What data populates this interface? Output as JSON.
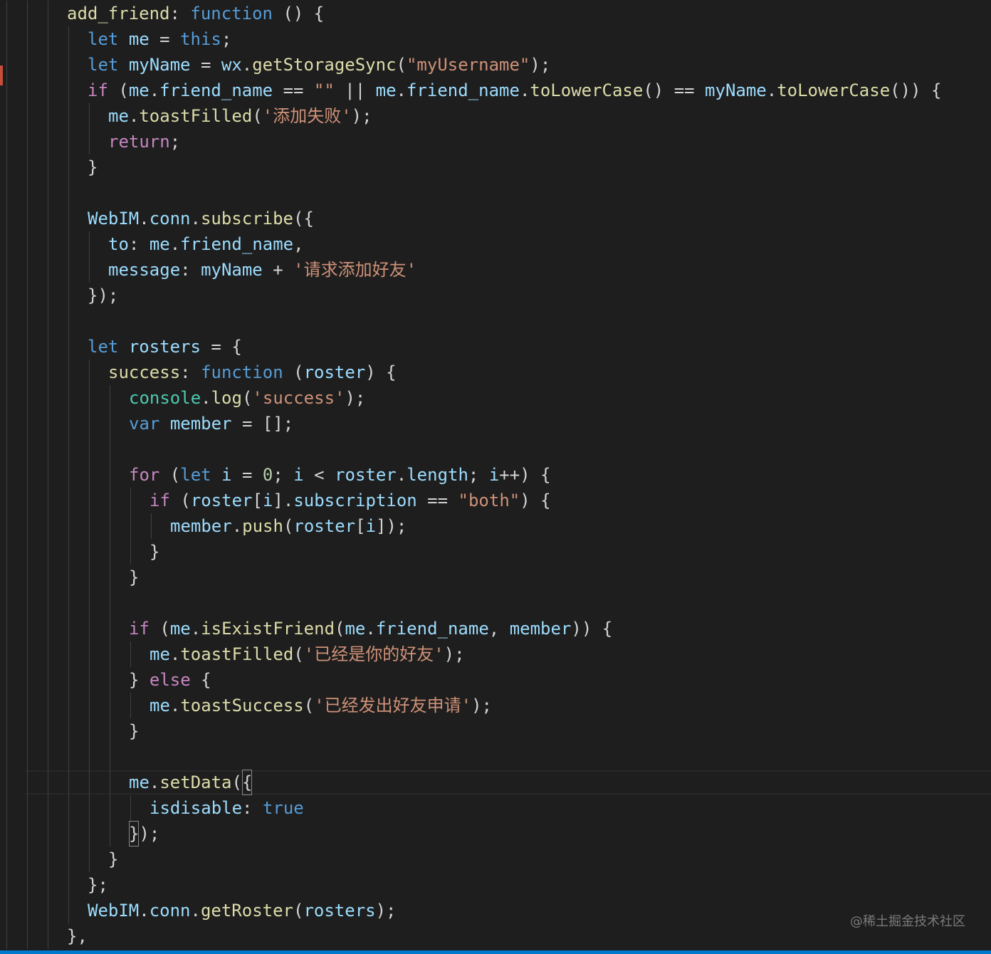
{
  "colors": {
    "background": "#1e1e1e",
    "plain": "#d4d4d4",
    "keyword": "#569cd6",
    "control": "#c586c0",
    "variable": "#9cdcfe",
    "function": "#dcdcaa",
    "string": "#ce9178",
    "number": "#b5cea8",
    "class": "#4ec9b0",
    "statusbar": "#007acc",
    "gutter_marker": "#c74e39"
  },
  "watermark": "@稀土掘金技术社区",
  "code": {
    "lines": [
      {
        "indent": 3,
        "tokens": [
          [
            "add_friend",
            "fn"
          ],
          [
            ": ",
            "p"
          ],
          [
            "function",
            "kw"
          ],
          [
            " () {",
            "p"
          ]
        ]
      },
      {
        "indent": 4,
        "tokens": [
          [
            "let",
            "kw"
          ],
          [
            " ",
            "p"
          ],
          [
            "me",
            "var"
          ],
          [
            " = ",
            "p"
          ],
          [
            "this",
            "kw"
          ],
          [
            ";",
            "p"
          ]
        ]
      },
      {
        "indent": 4,
        "tokens": [
          [
            "let",
            "kw"
          ],
          [
            " ",
            "p"
          ],
          [
            "myName",
            "var"
          ],
          [
            " = ",
            "p"
          ],
          [
            "wx",
            "var"
          ],
          [
            ".",
            "p"
          ],
          [
            "getStorageSync",
            "fn"
          ],
          [
            "(",
            "p"
          ],
          [
            "\"myUsername\"",
            "str"
          ],
          [
            ");",
            "p"
          ]
        ]
      },
      {
        "indent": 4,
        "tokens": [
          [
            "if",
            "ctl"
          ],
          [
            " (",
            "p"
          ],
          [
            "me",
            "var"
          ],
          [
            ".",
            "p"
          ],
          [
            "friend_name",
            "var"
          ],
          [
            " == ",
            "p"
          ],
          [
            "\"\"",
            "str"
          ],
          [
            " || ",
            "p"
          ],
          [
            "me",
            "var"
          ],
          [
            ".",
            "p"
          ],
          [
            "friend_name",
            "var"
          ],
          [
            ".",
            "p"
          ],
          [
            "toLowerCase",
            "fn"
          ],
          [
            "() == ",
            "p"
          ],
          [
            "myName",
            "var"
          ],
          [
            ".",
            "p"
          ],
          [
            "toLowerCase",
            "fn"
          ],
          [
            "()) {",
            "p"
          ]
        ]
      },
      {
        "indent": 5,
        "tokens": [
          [
            "me",
            "var"
          ],
          [
            ".",
            "p"
          ],
          [
            "toastFilled",
            "fn"
          ],
          [
            "(",
            "p"
          ],
          [
            "'添加失败'",
            "str"
          ],
          [
            ");",
            "p"
          ]
        ]
      },
      {
        "indent": 5,
        "tokens": [
          [
            "return",
            "ctl"
          ],
          [
            ";",
            "p"
          ]
        ]
      },
      {
        "indent": 4,
        "tokens": [
          [
            "}",
            "p"
          ]
        ]
      },
      {
        "indent": 0,
        "tokens": []
      },
      {
        "indent": 4,
        "tokens": [
          [
            "WebIM",
            "var"
          ],
          [
            ".",
            "p"
          ],
          [
            "conn",
            "var"
          ],
          [
            ".",
            "p"
          ],
          [
            "subscribe",
            "fn"
          ],
          [
            "({",
            "p"
          ]
        ]
      },
      {
        "indent": 5,
        "tokens": [
          [
            "to",
            "var"
          ],
          [
            ": ",
            "p"
          ],
          [
            "me",
            "var"
          ],
          [
            ".",
            "p"
          ],
          [
            "friend_name",
            "var"
          ],
          [
            ",",
            "p"
          ]
        ]
      },
      {
        "indent": 5,
        "tokens": [
          [
            "message",
            "var"
          ],
          [
            ": ",
            "p"
          ],
          [
            "myName",
            "var"
          ],
          [
            " + ",
            "p"
          ],
          [
            "'请求添加好友'",
            "str"
          ]
        ]
      },
      {
        "indent": 4,
        "tokens": [
          [
            "});",
            "p"
          ]
        ]
      },
      {
        "indent": 0,
        "tokens": []
      },
      {
        "indent": 4,
        "tokens": [
          [
            "let",
            "kw"
          ],
          [
            " ",
            "p"
          ],
          [
            "rosters",
            "var"
          ],
          [
            " = {",
            "p"
          ]
        ]
      },
      {
        "indent": 5,
        "tokens": [
          [
            "success",
            "fn"
          ],
          [
            ": ",
            "p"
          ],
          [
            "function",
            "kw"
          ],
          [
            " (",
            "p"
          ],
          [
            "roster",
            "var"
          ],
          [
            ") {",
            "p"
          ]
        ]
      },
      {
        "indent": 6,
        "tokens": [
          [
            "console",
            "cls"
          ],
          [
            ".",
            "p"
          ],
          [
            "log",
            "fn"
          ],
          [
            "(",
            "p"
          ],
          [
            "'success'",
            "str"
          ],
          [
            ");",
            "p"
          ]
        ]
      },
      {
        "indent": 6,
        "tokens": [
          [
            "var",
            "kw"
          ],
          [
            " ",
            "p"
          ],
          [
            "member",
            "var"
          ],
          [
            " = [];",
            "p"
          ]
        ]
      },
      {
        "indent": 0,
        "tokens": []
      },
      {
        "indent": 6,
        "tokens": [
          [
            "for",
            "ctl"
          ],
          [
            " (",
            "p"
          ],
          [
            "let",
            "kw"
          ],
          [
            " ",
            "p"
          ],
          [
            "i",
            "var"
          ],
          [
            " = ",
            "p"
          ],
          [
            "0",
            "num"
          ],
          [
            "; ",
            "p"
          ],
          [
            "i",
            "var"
          ],
          [
            " < ",
            "p"
          ],
          [
            "roster",
            "var"
          ],
          [
            ".",
            "p"
          ],
          [
            "length",
            "var"
          ],
          [
            "; ",
            "p"
          ],
          [
            "i",
            "var"
          ],
          [
            "++) {",
            "p"
          ]
        ]
      },
      {
        "indent": 7,
        "tokens": [
          [
            "if",
            "ctl"
          ],
          [
            " (",
            "p"
          ],
          [
            "roster",
            "var"
          ],
          [
            "[",
            "p"
          ],
          [
            "i",
            "var"
          ],
          [
            "].",
            "p"
          ],
          [
            "subscription",
            "var"
          ],
          [
            " == ",
            "p"
          ],
          [
            "\"both\"",
            "str"
          ],
          [
            ") {",
            "p"
          ]
        ]
      },
      {
        "indent": 8,
        "tokens": [
          [
            "member",
            "var"
          ],
          [
            ".",
            "p"
          ],
          [
            "push",
            "fn"
          ],
          [
            "(",
            "p"
          ],
          [
            "roster",
            "var"
          ],
          [
            "[",
            "p"
          ],
          [
            "i",
            "var"
          ],
          [
            "]);",
            "p"
          ]
        ]
      },
      {
        "indent": 7,
        "tokens": [
          [
            "}",
            "p"
          ]
        ]
      },
      {
        "indent": 6,
        "tokens": [
          [
            "}",
            "p"
          ]
        ]
      },
      {
        "indent": 0,
        "tokens": []
      },
      {
        "indent": 6,
        "tokens": [
          [
            "if",
            "ctl"
          ],
          [
            " (",
            "p"
          ],
          [
            "me",
            "var"
          ],
          [
            ".",
            "p"
          ],
          [
            "isExistFriend",
            "fn"
          ],
          [
            "(",
            "p"
          ],
          [
            "me",
            "var"
          ],
          [
            ".",
            "p"
          ],
          [
            "friend_name",
            "var"
          ],
          [
            ", ",
            "p"
          ],
          [
            "member",
            "var"
          ],
          [
            ")) {",
            "p"
          ]
        ]
      },
      {
        "indent": 7,
        "tokens": [
          [
            "me",
            "var"
          ],
          [
            ".",
            "p"
          ],
          [
            "toastFilled",
            "fn"
          ],
          [
            "(",
            "p"
          ],
          [
            "'已经是你的好友'",
            "str"
          ],
          [
            ");",
            "p"
          ]
        ]
      },
      {
        "indent": 6,
        "tokens": [
          [
            "} ",
            "p"
          ],
          [
            "else",
            "ctl"
          ],
          [
            " {",
            "p"
          ]
        ]
      },
      {
        "indent": 7,
        "tokens": [
          [
            "me",
            "var"
          ],
          [
            ".",
            "p"
          ],
          [
            "toastSuccess",
            "fn"
          ],
          [
            "(",
            "p"
          ],
          [
            "'已经发出好友申请'",
            "str"
          ],
          [
            ");",
            "p"
          ]
        ]
      },
      {
        "indent": 6,
        "tokens": [
          [
            "}",
            "p"
          ]
        ]
      },
      {
        "indent": 0,
        "tokens": []
      },
      {
        "indent": 6,
        "tokens": [
          [
            "me",
            "var"
          ],
          [
            ".",
            "p"
          ],
          [
            "setData",
            "fn"
          ],
          [
            "(",
            "p"
          ],
          [
            "{",
            "box"
          ]
        ]
      },
      {
        "indent": 7,
        "tokens": [
          [
            "isdisable",
            "var"
          ],
          [
            ": ",
            "p"
          ],
          [
            "true",
            "kw"
          ]
        ]
      },
      {
        "indent": 6,
        "tokens": [
          [
            "}",
            "box"
          ],
          [
            ");",
            "p"
          ]
        ]
      },
      {
        "indent": 5,
        "tokens": [
          [
            "}",
            "p"
          ]
        ]
      },
      {
        "indent": 4,
        "tokens": [
          [
            "};",
            "p"
          ]
        ]
      },
      {
        "indent": 4,
        "tokens": [
          [
            "WebIM",
            "var"
          ],
          [
            ".",
            "p"
          ],
          [
            "conn",
            "var"
          ],
          [
            ".",
            "p"
          ],
          [
            "getRoster",
            "fn"
          ],
          [
            "(",
            "p"
          ],
          [
            "rosters",
            "var"
          ],
          [
            ");",
            "p"
          ]
        ]
      },
      {
        "indent": 3,
        "tokens": [
          [
            "},",
            "p"
          ]
        ]
      }
    ]
  }
}
